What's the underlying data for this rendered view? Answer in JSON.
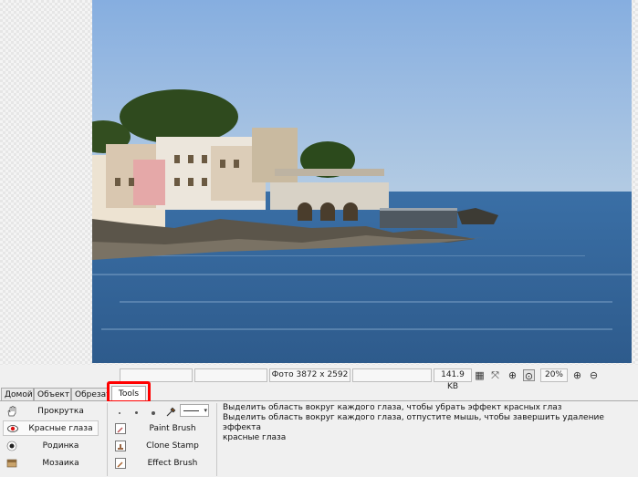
{
  "statusbar": {
    "photo_info": "Фото 3872 x 2592",
    "file_size": "141.9 KB",
    "zoom": "20%"
  },
  "tabs": [
    {
      "label": "Домой",
      "active": false
    },
    {
      "label": "Объект",
      "active": false
    },
    {
      "label": "Обрезат",
      "active": false
    },
    {
      "label": "Tools",
      "active": true
    }
  ],
  "left_tools": [
    {
      "label": "Прокрутка",
      "icon": "hand-icon",
      "selected": false
    },
    {
      "label": "Красные глаза",
      "icon": "eye-icon",
      "selected": true
    },
    {
      "label": "Родинка",
      "icon": "mole-icon",
      "selected": false
    },
    {
      "label": "Мозаика",
      "icon": "mosaic-icon",
      "selected": false
    }
  ],
  "brush_tools": [
    {
      "label": "Paint Brush",
      "icon": "paint-brush-icon"
    },
    {
      "label": "Clone Stamp",
      "icon": "clone-stamp-icon"
    },
    {
      "label": "Effect Brush",
      "icon": "effect-brush-icon"
    }
  ],
  "description": {
    "line1": "Выделить область вокруг каждого глаза, чтобы убрать эффект красных глаз",
    "line2": "Выделить область вокруг каждого глаза, отпустите мышь, чтобы завершить удаление эффекта",
    "line3": "красные глаза"
  },
  "colors": {
    "highlight": "#ff0000",
    "sky": "#8fb4dd",
    "sea": "#3f6f9f"
  }
}
